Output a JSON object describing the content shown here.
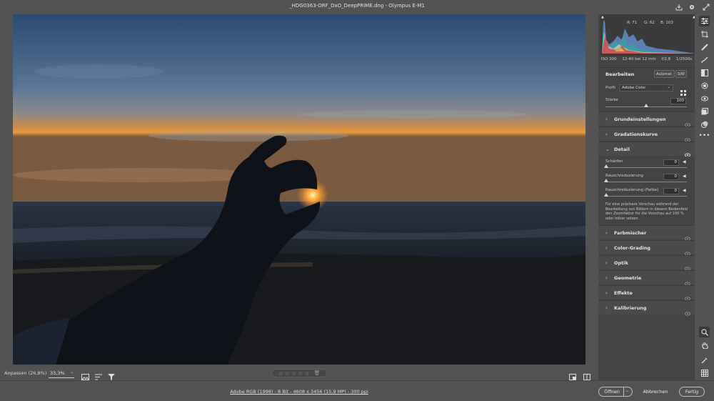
{
  "window": {
    "title": "_HDG0363-ORF_DxO_DeepPRIME.dng  -  Olympus E-M1"
  },
  "histogram": {
    "r": "R: 71",
    "g": "G: 62",
    "b": "B: 103"
  },
  "exif": {
    "iso": "ISO 200",
    "lens": "12-40 bei 12 mm",
    "aperture": "f/2,8",
    "shutter": "1/2500s"
  },
  "edit": {
    "title": "Bearbeiten",
    "auto_label": "Automat.",
    "bw_label": "S/W",
    "profile_label": "Profil",
    "profile_value": "Adobe Color",
    "amount_label": "Stärke",
    "amount_value": "100"
  },
  "sections": {
    "grund": "Grundeinstellungen",
    "grad": "Gradationskurve",
    "detail": "Detail",
    "farb": "Farbmischer",
    "color": "Color-Grading",
    "optik": "Optik",
    "geo": "Geometrie",
    "eff": "Effekte",
    "kal": "Kalibrierung"
  },
  "detail": {
    "sharpen_label": "Schärfen",
    "sharpen_value": "0",
    "noise_label": "Rauschreduzierung",
    "noise_value": "0",
    "color_noise_label": "Rauschreduzierung (Farbe)",
    "color_noise_value": "0",
    "hint": "Für eine präzisere Vorschau während der Bearbeitung von Bildern in diesem Bedienfeld den Zoomfaktor für die Vorschau auf 100 % oder höher setzen."
  },
  "bottom": {
    "fit_label": "Anpassen (26,8%)",
    "zoom_value": "33,3%"
  },
  "footer": {
    "info": "Adobe RGB (1998) - 8 Bit - 4608 x 3456 (15,9 MP) - 300 ppi",
    "open": "Öffnen",
    "cancel": "Abbrechen",
    "done": "Fertig"
  },
  "colors": {
    "accent": "#1473e6",
    "panel": "#434343",
    "bg": "#535353"
  }
}
